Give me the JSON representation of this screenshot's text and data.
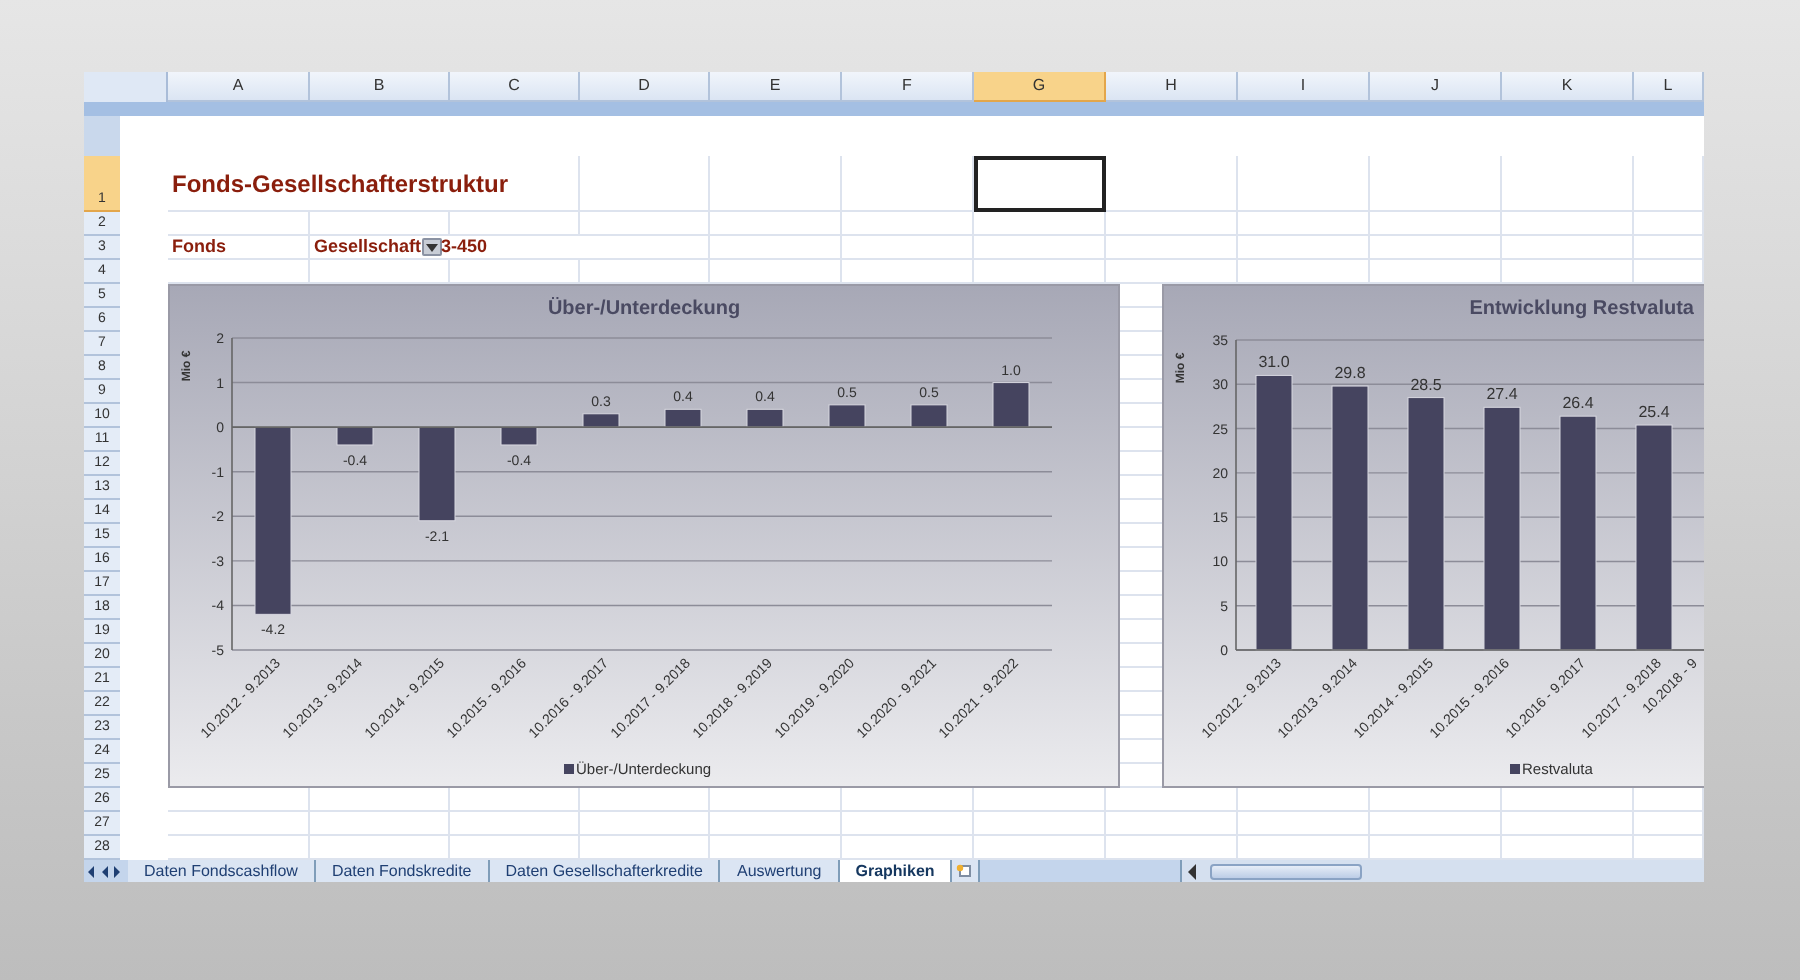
{
  "sheet": {
    "columns": [
      {
        "label": "A",
        "selected": false
      },
      {
        "label": "B",
        "selected": false
      },
      {
        "label": "C",
        "selected": false
      },
      {
        "label": "D",
        "selected": false
      },
      {
        "label": "E",
        "selected": false
      },
      {
        "label": "F",
        "selected": false
      },
      {
        "label": "G",
        "selected": true
      },
      {
        "label": "H",
        "selected": false
      },
      {
        "label": "I",
        "selected": false
      },
      {
        "label": "J",
        "selected": false
      },
      {
        "label": "K",
        "selected": false
      },
      {
        "label": "L",
        "selected": false
      }
    ],
    "rows": [
      {
        "label": "1",
        "selected": true
      },
      {
        "label": "2",
        "selected": false
      },
      {
        "label": "3",
        "selected": false
      },
      {
        "label": "4",
        "selected": false
      },
      {
        "label": "5",
        "selected": false
      },
      {
        "label": "6",
        "selected": false
      },
      {
        "label": "7",
        "selected": false
      },
      {
        "label": "8",
        "selected": false
      },
      {
        "label": "9",
        "selected": false
      },
      {
        "label": "10",
        "selected": false
      },
      {
        "label": "11",
        "selected": false
      },
      {
        "label": "12",
        "selected": false
      },
      {
        "label": "13",
        "selected": false
      },
      {
        "label": "14",
        "selected": false
      },
      {
        "label": "15",
        "selected": false
      },
      {
        "label": "16",
        "selected": false
      },
      {
        "label": "17",
        "selected": false
      },
      {
        "label": "18",
        "selected": false
      },
      {
        "label": "19",
        "selected": false
      },
      {
        "label": "20",
        "selected": false
      },
      {
        "label": "21",
        "selected": false
      },
      {
        "label": "22",
        "selected": false
      },
      {
        "label": "23",
        "selected": false
      },
      {
        "label": "24",
        "selected": false
      },
      {
        "label": "25",
        "selected": false
      },
      {
        "label": "26",
        "selected": false
      },
      {
        "label": "27",
        "selected": false
      },
      {
        "label": "28",
        "selected": false
      }
    ],
    "title_cell": {
      "text": "Fonds-Gesellschafterstruktur"
    },
    "fund_row": {
      "label": "Fonds",
      "value_parts": [
        "Gesellschaft",
        "3-450"
      ]
    }
  },
  "charts": [
    {
      "chart_data": {
        "type": "bar",
        "title": "Über-/Unterdeckung",
        "ylabel": "Mio €",
        "categories": [
          "10.2012 - 9.2013",
          "10.2013 - 9.2014",
          "10.2014 - 9.2015",
          "10.2015 - 9.2016",
          "10.2016 - 9.2017",
          "10.2017 - 9.2018",
          "10.2018 - 9.2019",
          "10.2019 - 9.2020",
          "10.2020 - 9.2021",
          "10.2021 - 9.2022"
        ],
        "series": [
          {
            "name": "Über-/Unterdeckung",
            "color": "#45445f",
            "values": [
              -4.2,
              -0.4,
              -2.1,
              -0.4,
              0.3,
              0.4,
              0.4,
              0.5,
              0.5,
              1.0
            ],
            "value_labels": [
              "-4.2",
              "-0.4",
              "-2.1",
              "-0.4",
              "0.3",
              "0.4",
              "0.4",
              "0.5",
              "0.5",
              "1.0"
            ]
          }
        ],
        "ylim": [
          -5,
          2
        ],
        "yticks": [
          -5,
          -4,
          -3,
          -2,
          -1,
          0,
          1,
          2
        ],
        "grid": true,
        "data_labels": true
      }
    },
    {
      "chart_data": {
        "type": "bar",
        "title": "Entwicklung Restvaluta",
        "ylabel": "Mio €",
        "categories": [
          "10.2012 - 9.2013",
          "10.2013 - 9.2014",
          "10.2014 - 9.2015",
          "10.2015 - 9.2016",
          "10.2016 - 9.2017",
          "10.2017 - 9.2018",
          "10.2018 - 9"
        ],
        "series": [
          {
            "name": "Restvaluta",
            "color": "#45445f",
            "values": [
              31.0,
              29.8,
              28.5,
              27.4,
              26.4,
              25.4,
              null
            ],
            "value_labels": [
              "31.0",
              "29.8",
              "28.5",
              "27.4",
              "26.4",
              "25.4",
              null
            ]
          }
        ],
        "ylim": [
          0,
          35
        ],
        "yticks": [
          0,
          5,
          10,
          15,
          20,
          25,
          30,
          35
        ],
        "grid": true,
        "data_labels": true
      }
    }
  ],
  "sheet_tabs": [
    {
      "label": "Daten Fondscashflow",
      "selected": false
    },
    {
      "label": "Daten Fondskredite",
      "selected": false
    },
    {
      "label": "Daten Gesellschafterkredite",
      "selected": false
    },
    {
      "label": "Auswertung",
      "selected": false
    },
    {
      "label": "Graphiken",
      "selected": true
    }
  ]
}
